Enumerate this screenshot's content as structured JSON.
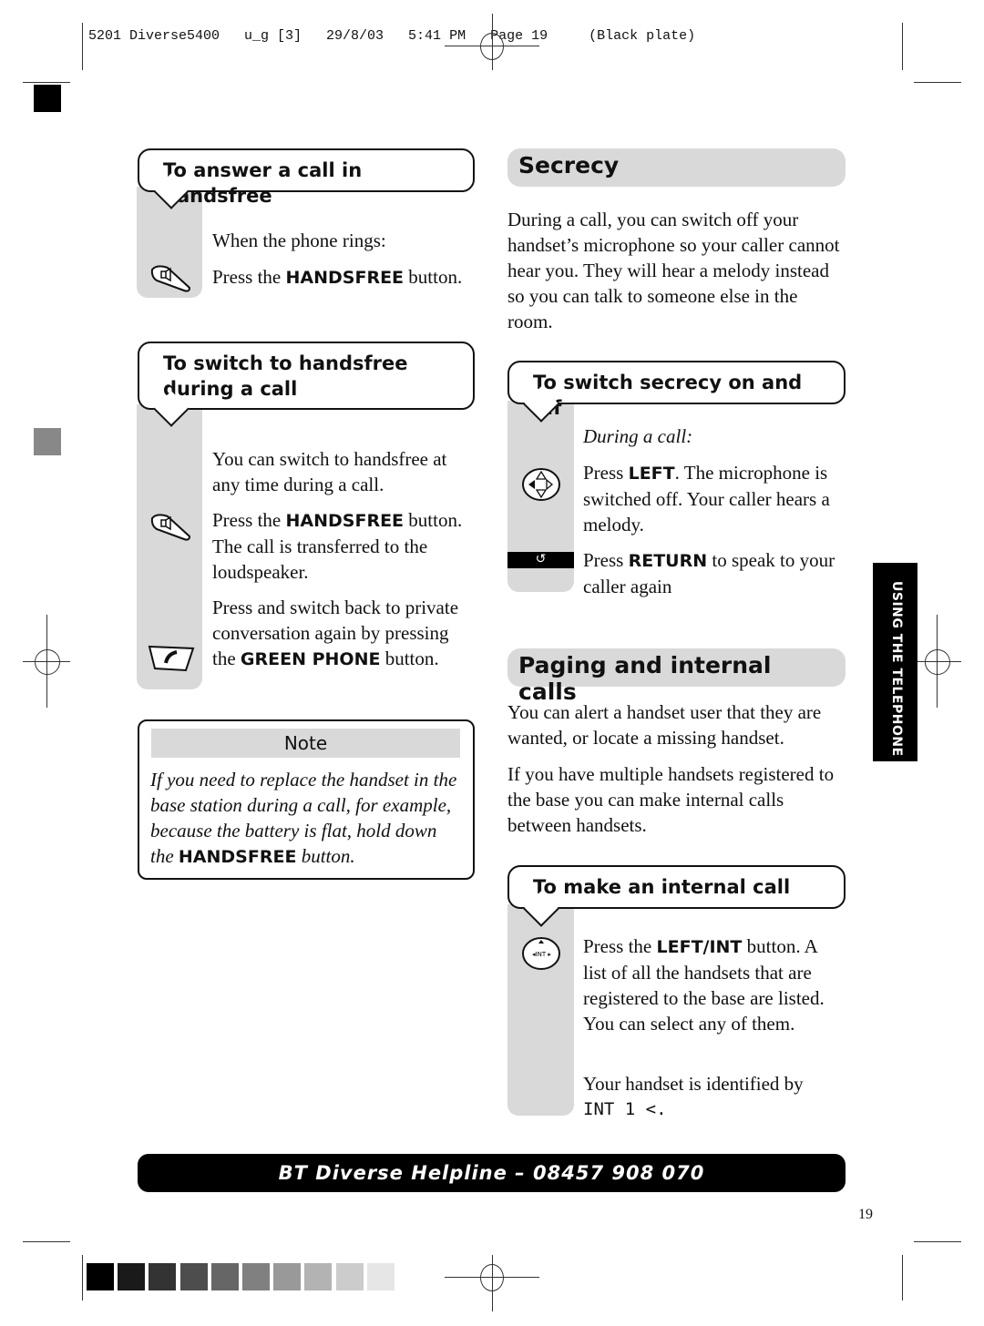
{
  "slug": "5201 Diverse5400   u_g [3]   29/8/03   5:41 PM   Page 19     (Black plate)",
  "left": {
    "answer": {
      "title": "To answer a call in handsfree",
      "line1": "When the phone rings:",
      "p_pre": "Press the ",
      "p_bold": "HANDSFREE",
      "p_post": " button."
    },
    "switch": {
      "title": "To switch to handsfree during a call",
      "line1": "You can switch to handsfree at any time during a call.",
      "p2_pre": "Press the ",
      "p2_bold": "HANDSFREE",
      "p2_post": " button. The call is transferred to the loudspeaker.",
      "p3_pre": "Press and switch back to private conversation again by pressing the ",
      "p3_bold": "GREEN PHONE",
      "p3_post": " button."
    },
    "note": {
      "title": "Note",
      "text_pre": "If you need to replace the handset in the base station during a call, for example, because the battery is flat, hold down the ",
      "text_bold": "HANDSFREE",
      "text_post": " button."
    }
  },
  "right": {
    "secrecy": {
      "title": "Secrecy",
      "para": "During a call, you can switch off your handset’s microphone so your caller cannot hear you. They will hear a melody instead so you can talk to someone else in the room.",
      "box_title": "To switch secrecy on and off",
      "during": "During a call:",
      "p1_pre": "Press ",
      "p1_bold": "LEFT",
      "p1_post": ". The microphone is switched off. Your caller hears a melody.",
      "p2_pre": "Press ",
      "p2_bold": "RETURN",
      "p2_post": " to speak to your caller again"
    },
    "paging": {
      "title": "Paging and internal calls",
      "para1": "You can alert a handset user that they are wanted, or locate a missing handset.",
      "para2": "If you have multiple handsets registered to the base you can make internal calls between handsets.",
      "box_title": "To make an internal call",
      "p1_pre": "Press the ",
      "p1_bold": "LEFT/INT",
      "p1_post": " button. A list of all the handsets that are registered to the base are listed. You can select any of them.",
      "p2": "Your handset is identified by",
      "display": "INT 1 <."
    }
  },
  "side_tab": "USING THE TELEPHONE",
  "helpline": "BT Diverse Helpline – 08457 908 070",
  "page_number": "19",
  "icons": {
    "handsfree": "handsfree-button-icon",
    "nav": "navigation-key-icon",
    "return": "return-key-icon",
    "phone": "green-phone-icon",
    "int": "left-int-key-icon"
  },
  "colors": {
    "strip": "#d9d9d9",
    "swatches": [
      "#000000",
      "#1a1a1a",
      "#333333",
      "#4d4d4d",
      "#666666",
      "#808080",
      "#999999",
      "#b3b3b3",
      "#cccccc",
      "#e6e6e6"
    ]
  }
}
